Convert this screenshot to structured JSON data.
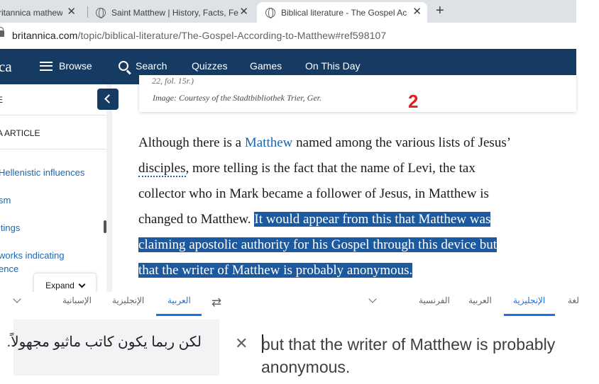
{
  "browser": {
    "tabs": [
      {
        "title": "ritannica mathew",
        "active": false
      },
      {
        "title": "Saint Matthew | History, Facts, Fe",
        "active": false
      },
      {
        "title": "Biblical literature - The Gospel Ac",
        "active": true
      }
    ],
    "url_host": "britannica.com",
    "url_path": "/topic/biblical-literature/The-Gospel-According-to-Matthew#ref598107"
  },
  "nav": {
    "logo": "ca",
    "browse": "Browse",
    "search": "Search",
    "quizzes": "Quizzes",
    "games": "Games",
    "on_this_day": "On This Day"
  },
  "sidebar": {
    "heading": "E",
    "article_label": "A ARTICLE",
    "items": [
      "Hellenistic influences",
      "sm",
      "itings",
      "works indicating",
      "ence"
    ],
    "expand": "Expand"
  },
  "article": {
    "caption_top": "22, fol. 15r.)",
    "caption": "Image: Courtesy of the Stadtbibliothek Trier, Ger.",
    "annotation": "2",
    "line1_pre": "Although there is a ",
    "line1_link": "Matthew",
    "line1_post": " named among the various lists of Jesus’",
    "line2_link": "disciples",
    "line2_post": ", more telling is the fact that the name of Levi, the tax",
    "line3": "collector who in Mark became a follower of Jesus, in Matthew is",
    "line4_pre": "changed to Matthew. ",
    "line4_hl": "It would appear from this that Matthew was",
    "line5_hl": "claiming apostolic authority for his Gospel through this device but",
    "line6_hl": "that the writer of Matthew is probably anonymous."
  },
  "translator": {
    "target_langs": [
      "الإسبانية",
      "الإنجليزية",
      "العربية"
    ],
    "source_langs": [
      "الفرنسية",
      "العربية",
      "الإنجليزية",
      "لغة"
    ],
    "output": "لكن ربما يكون كاتب ماثيو مجهولاً.",
    "input": "but that the writer of Matthew is probably anonymous."
  },
  "colors": {
    "nav_bg": "#163b63",
    "highlight": "#1b5aa0",
    "link": "#1b66b3",
    "annotation": "#e0201e",
    "translator_accent": "#1a73e8"
  }
}
